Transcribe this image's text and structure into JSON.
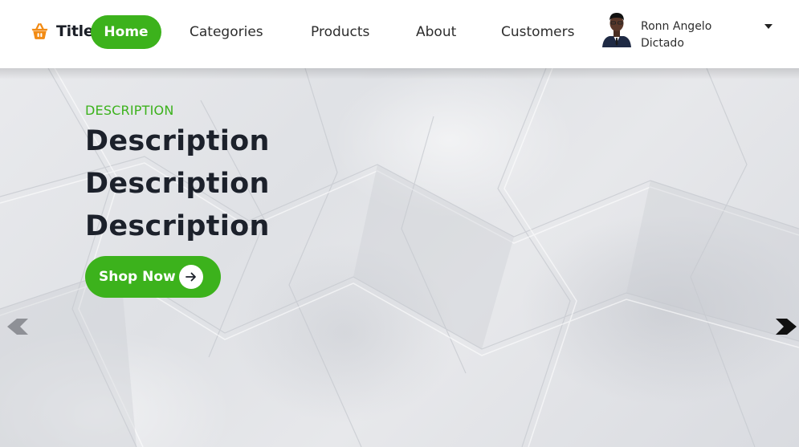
{
  "brand": {
    "title": "Title",
    "icon": "basket-icon",
    "icon_color": "#f28b14"
  },
  "nav": {
    "items": [
      {
        "label": "Home",
        "active": true
      },
      {
        "label": "Categories",
        "active": false
      },
      {
        "label": "Products",
        "active": false
      },
      {
        "label": "About",
        "active": false
      },
      {
        "label": "Customers",
        "active": false
      }
    ]
  },
  "user": {
    "name": "Ronn Angelo Dictado",
    "avatar": "user-avatar",
    "menu_icon": "caret-down-icon"
  },
  "hero": {
    "eyebrow": "DESCRIPTION",
    "lines": [
      "Description",
      "Description",
      "Description"
    ],
    "cta_label": "Shop Now",
    "cta_icon": "arrow-right-icon",
    "background": "crumpled-paper-texture"
  },
  "carousel": {
    "prev_icon": "chevron-left-icon",
    "next_icon": "chevron-right-icon"
  },
  "colors": {
    "accent": "#3cb21c",
    "heading": "#1c212b",
    "nav_text": "#2d2d2d",
    "brand_icon": "#f28b14",
    "navbar_bg": "#ffffff"
  }
}
